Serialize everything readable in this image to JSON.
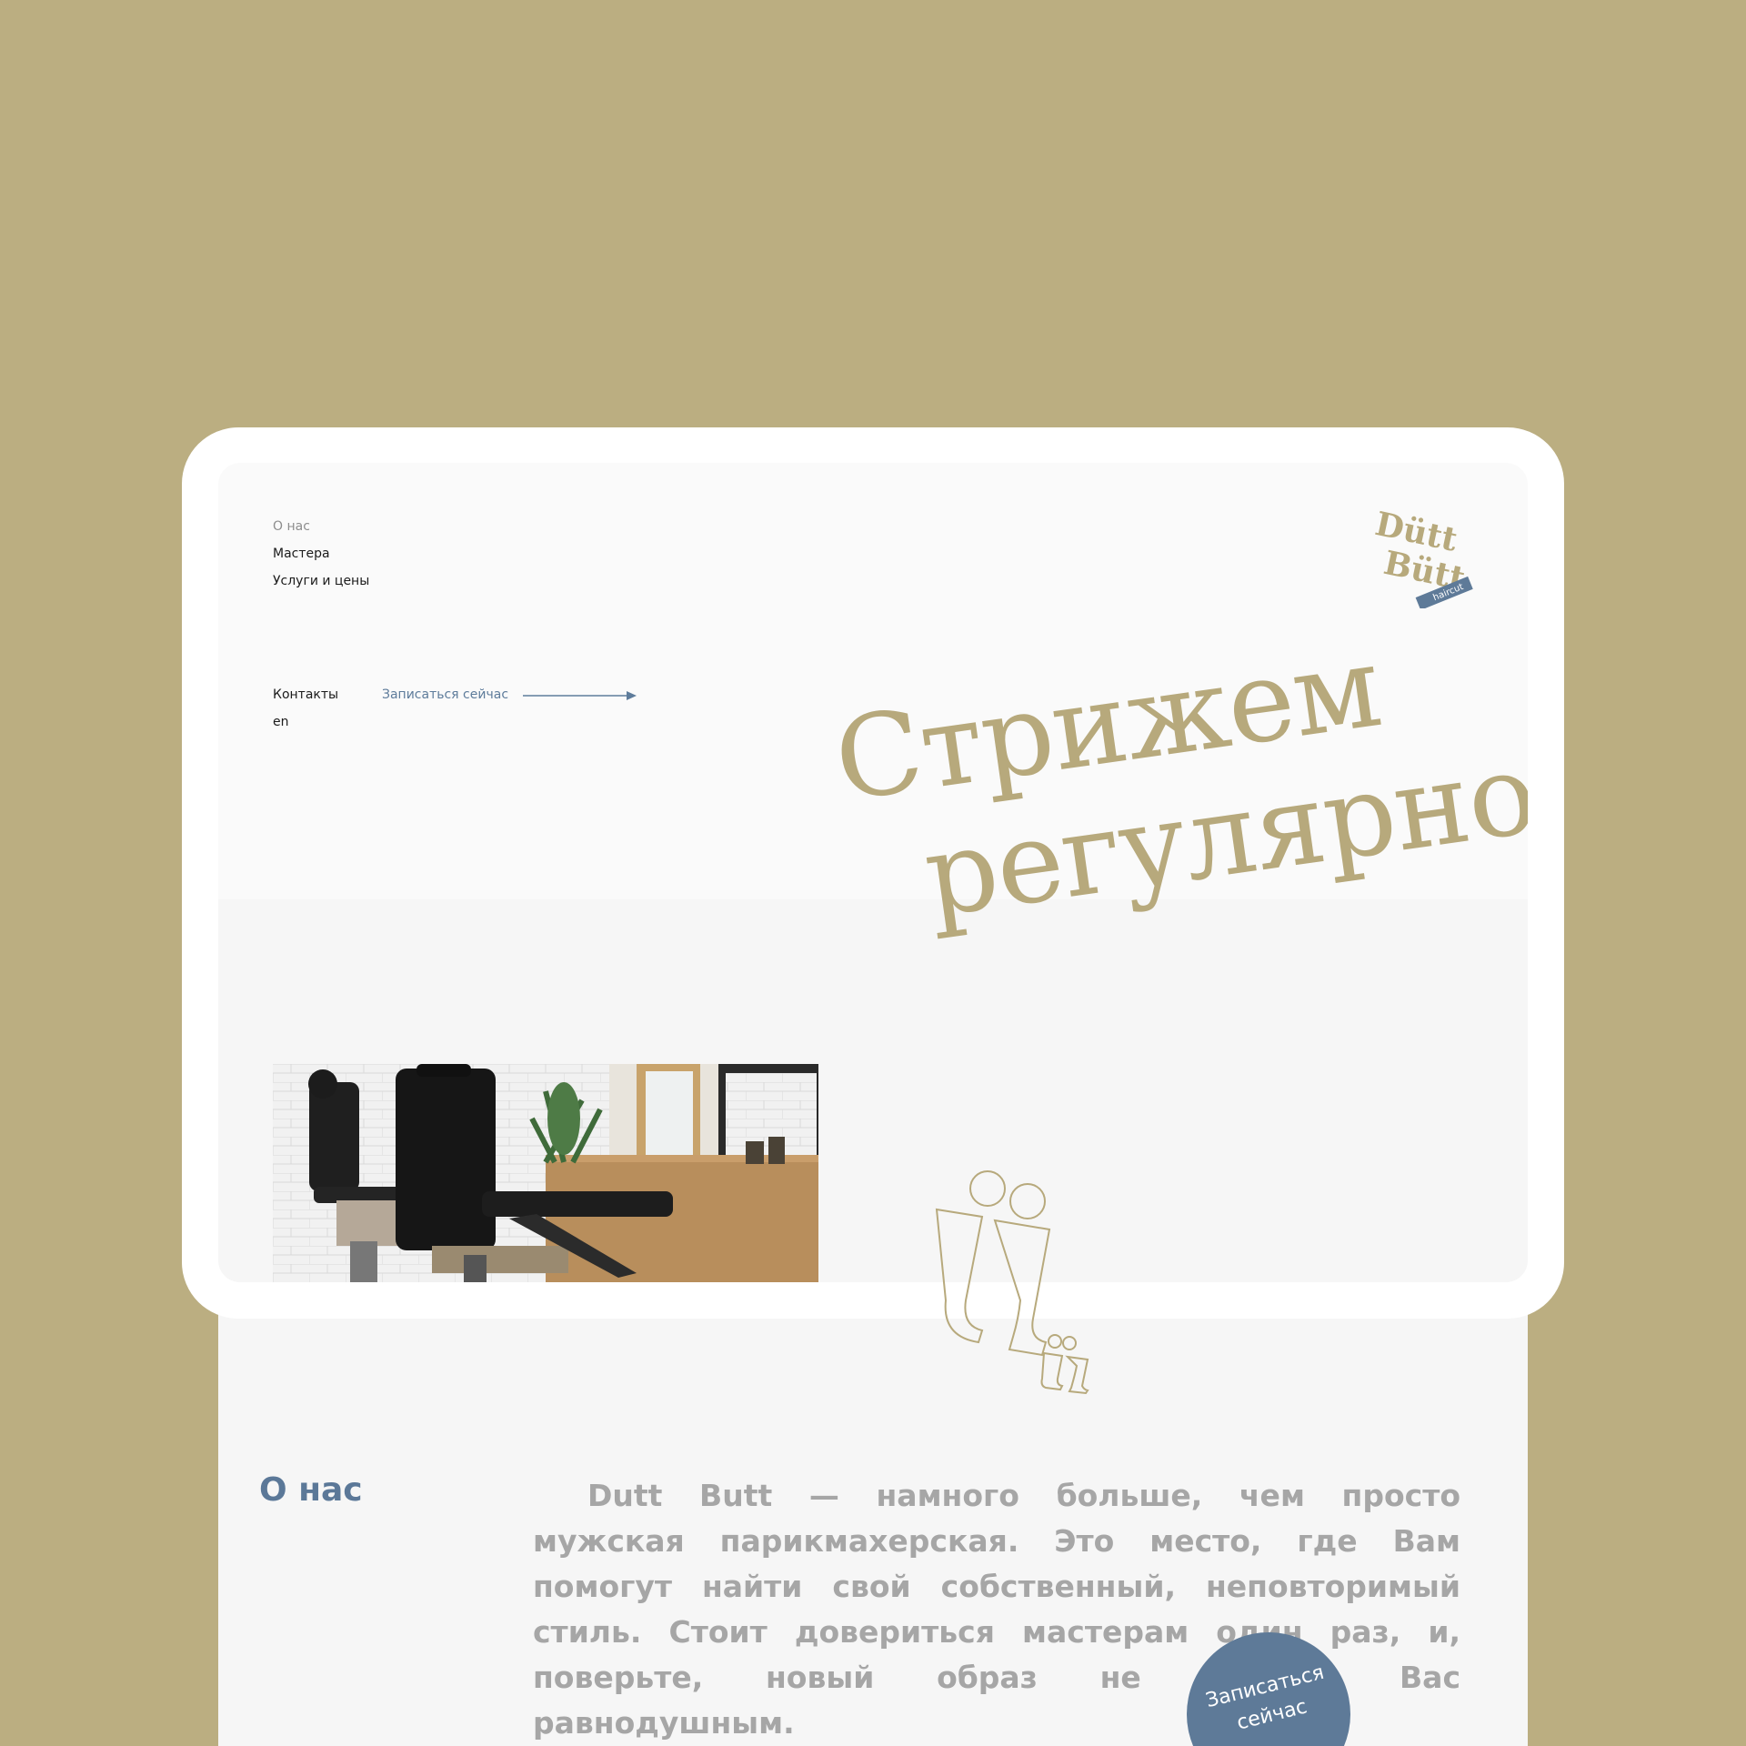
{
  "nav": {
    "about": "О нас",
    "masters": "Мастера",
    "services": "Услуги и цены",
    "contacts": "Контакты",
    "lang": "en",
    "book_now": "Записаться сейчас"
  },
  "logo": {
    "line1": "Dütt",
    "line2": "Bütt",
    "tag": "haircut"
  },
  "hero": {
    "line1": "Стрижем",
    "line2": "регулярно"
  },
  "about": {
    "title": "О нас",
    "text": "Dutt Butt — намного больше, чем просто мужская парикмахерская. Это место, где Вам помогут найти свой собственный, неповторимый стиль. Стоит довериться мастерам один раз, и, поверьте, новый образ не оставит Вас равнодушным."
  },
  "badge": {
    "label": "Записаться сейчас"
  },
  "colors": {
    "background": "#bbae81",
    "accent_gold": "#b7a97c",
    "accent_blue": "#5e7a98",
    "text_gray": "#a6a6a6"
  },
  "icons": {
    "cta_arrow": "arrow-right-icon"
  }
}
